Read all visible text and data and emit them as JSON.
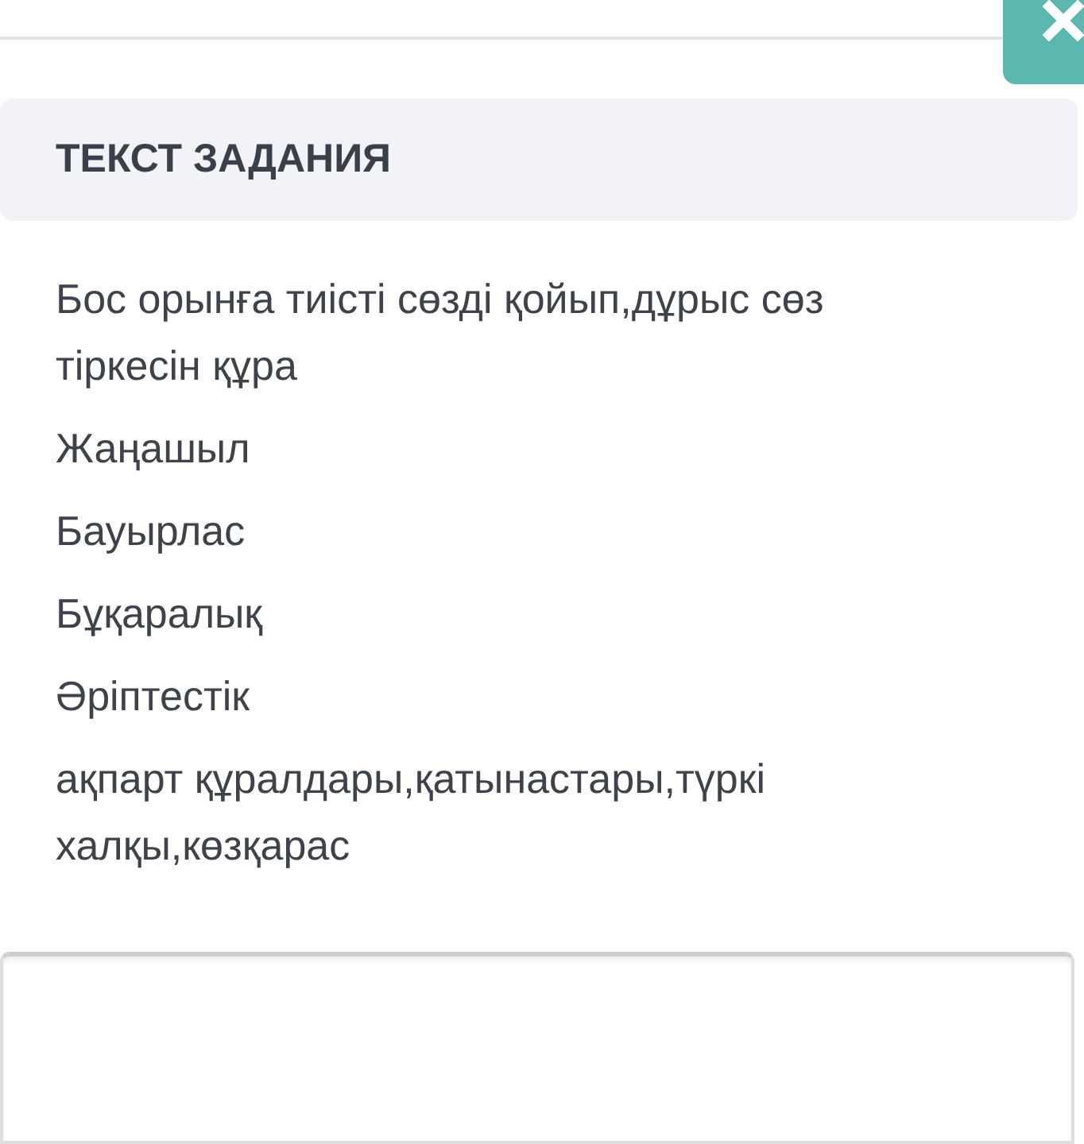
{
  "header": {
    "title": "ТЕКСТ ЗАДАНИЯ"
  },
  "paragraphs": [
    "Бос орынға тиісті сөзді қойып,дұрыс сөз тіркесін құра",
    "Жаңашыл",
    "Бауырлас",
    "Бұқаралық",
    "Әріптестік",
    "ақпарт құралдары,қатынастары,түркі халқы,көзқарас"
  ]
}
